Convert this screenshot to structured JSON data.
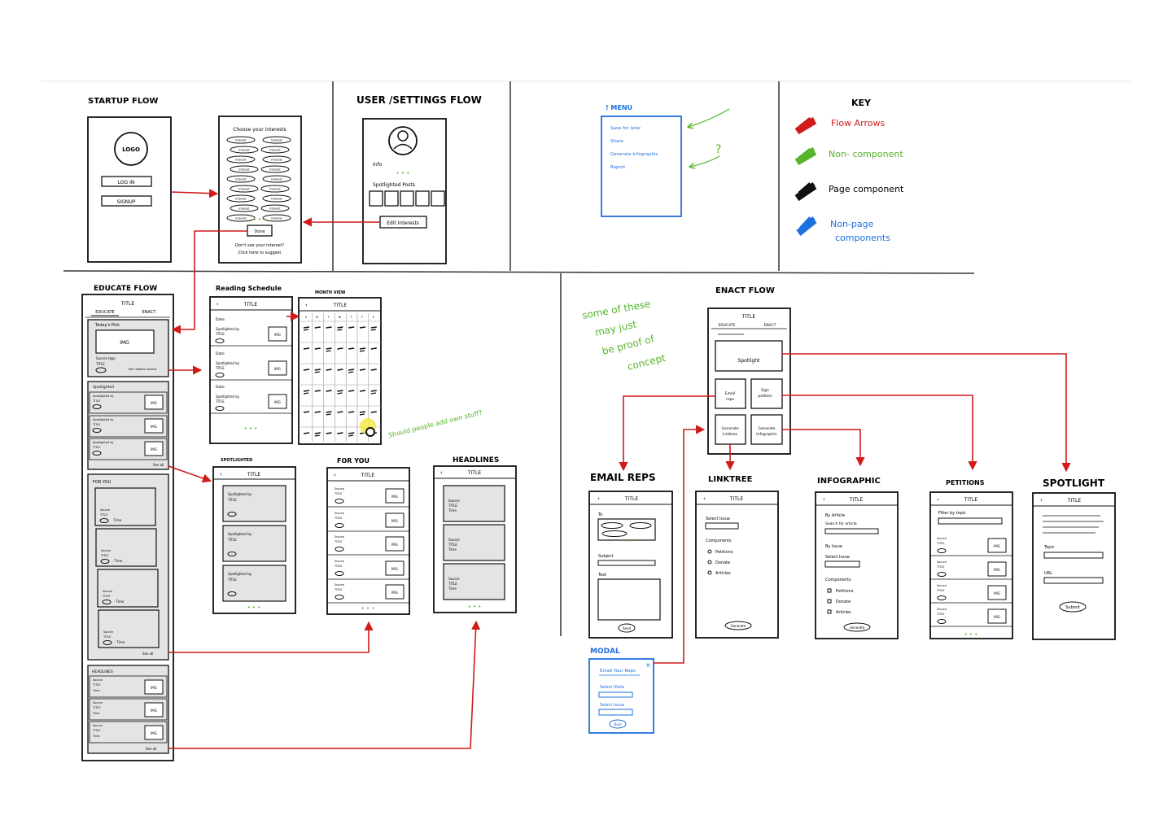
{
  "colors": {
    "flow_arrow": "#d11a1a",
    "non_component": "#55b52b",
    "page_component": "#111111",
    "non_page_component": "#1e6fe0",
    "placeholder_fill": "#e4e4e4",
    "highlight": "#f3e93a"
  },
  "sections": {
    "startup": "STARTUP FLOW",
    "user_settings": "USER /SETTINGS FLOW",
    "educate": "EDUCATE FLOW",
    "enact": "ENACT FLOW"
  },
  "key": {
    "title": "KEY",
    "flow_arrows": "Flow Arrows",
    "non_component": "Non- component",
    "page_component": "Page component",
    "non_page_line1": "Non-page",
    "non_page_line2": "components"
  },
  "startup": {
    "logo": "LOGO",
    "login": "LOG IN",
    "signup": "SIGNUP",
    "interests_title": "Choose your interests",
    "interest_pill": "Interest",
    "done": "Done",
    "dots": "• • •",
    "footer_line1": "Don't see your interest?",
    "footer_line2": "Click here to suggest"
  },
  "user": {
    "info": "Info",
    "dots": "• • •",
    "spotlighted_posts": "Spotlighted Posts",
    "edit_interests": "Edit Interests"
  },
  "menu": {
    "title": "! MENU",
    "items": [
      "Save for later",
      "Share",
      "Generate Infographic",
      "Report"
    ],
    "qmark": "?"
  },
  "educate": {
    "title": "TITLE",
    "tab_educate": "EDUCATE",
    "tab_enact": "ENACT",
    "todays_pick": "Today's Pick",
    "img": "IMG",
    "source_tags": "Source tags",
    "title_small": "TITLE",
    "tag": "TAG",
    "more_link": "See related content",
    "spotlighted": "Spotlighted",
    "spot_by": "Spotlighted by",
    "see_all": "See all",
    "for_you": "FOR YOU",
    "source": "Source",
    "time": "Time",
    "headlines": "HEADLINES",
    "dots": "• • •"
  },
  "reading": {
    "label": "Reading Schedule",
    "title": "TITLE",
    "date": "Date",
    "spot_by": "Spotlighted by",
    "title_small": "TITLE",
    "img": "IMG",
    "dots": "• • •",
    "month_label": "MONTH VIEW",
    "weekdays": [
      "S",
      "M",
      "T",
      "W",
      "T",
      "F",
      "S"
    ],
    "note": "Should people add own stuff?"
  },
  "lists": {
    "spotlighted_label": "SPOTLIGHTED",
    "foryou_label": "FOR YOU",
    "headlines_label": "HEADLINES",
    "title": "TITLE",
    "spot_by": "Spotlighted by",
    "source": "Source",
    "title_small": "TITLE",
    "time": "Time",
    "img": "IMG",
    "dots": "• • •"
  },
  "enact": {
    "title": "TITLE",
    "tab_educate": "EDUCATE",
    "tab_enact": "ENACT",
    "spotlight": "Spotlight",
    "tile_email_line1": "Email",
    "tile_email_line2": "reps",
    "tile_sign_line1": "Sign",
    "tile_sign_line2": "petition",
    "tile_gen_line1": "Generate",
    "tile_gen_line2": "Linktree",
    "tile_info_line1": "Generate",
    "tile_info_line2": "Infographic",
    "note_line1": "some of these",
    "note_line2": "may just",
    "note_line3": "be proof of",
    "note_line4": "concept"
  },
  "email": {
    "label": "EMAIL REPS",
    "title": "TITLE",
    "to": "To",
    "dots": "• • •",
    "subject": "Subject",
    "text": "Text",
    "send": "Send"
  },
  "linktree": {
    "label": "LINKTREE",
    "title": "TITLE",
    "select_issue": "Select Issue",
    "components": "Components",
    "options": [
      "Petitions",
      "Donate",
      "Articles"
    ],
    "generate": "Generate"
  },
  "infographic": {
    "label": "INFOGRAPHIC",
    "title": "TITLE",
    "by_article": "By Article",
    "search": "Search for article",
    "by_issue": "By Issue",
    "select_issue": "Select Issue",
    "components": "Components",
    "options": [
      "Petitions",
      "Donate",
      "Articles"
    ],
    "generate": "Generate"
  },
  "petitions": {
    "label": "PETITIONS",
    "title": "TITLE",
    "filter": "Filter by topic",
    "source": "Source",
    "title_small": "TITLE",
    "tag": "TAG",
    "img": "IMG",
    "dots": "• • •"
  },
  "spotlight": {
    "label": "SPOTLIGHT",
    "title": "TITLE",
    "topic": "Topic",
    "url": "URL",
    "submit": "Submit"
  },
  "modal": {
    "label": "MODAL",
    "email_reps": "Email Your Reps",
    "select_state": "Select State",
    "select_issue": "Select Issue",
    "next": "Next"
  }
}
